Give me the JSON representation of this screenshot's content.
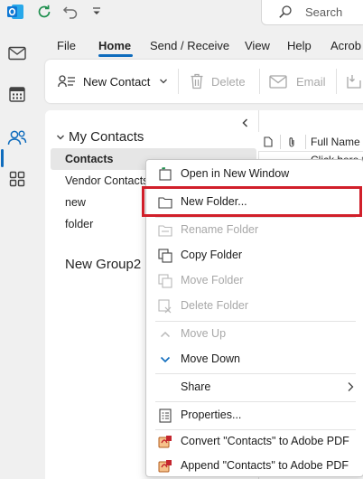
{
  "titlebar": {
    "search_label": "Search"
  },
  "tabs": [
    "File",
    "Home",
    "Send / Receive",
    "View",
    "Help",
    "Acrob"
  ],
  "ribbon": {
    "new_contact": "New Contact",
    "delete": "Delete",
    "email": "Email"
  },
  "folder_pane": {
    "header": "My Contacts",
    "items": [
      "Contacts",
      "Vendor Contacts",
      "new",
      "folder"
    ],
    "group": "New Group2"
  },
  "list_pane": {
    "col_full_name": "Full Name",
    "first_row": "Click here t"
  },
  "context_menu": {
    "items": [
      {
        "label": "Open in New Window",
        "enabled": true,
        "icon": "open-window-icon"
      },
      {
        "label": "New Folder...",
        "enabled": true,
        "icon": "folder-icon",
        "highlighted": true
      },
      {
        "label": "Rename Folder",
        "enabled": false,
        "icon": "rename-icon"
      },
      {
        "label": "Copy Folder",
        "enabled": true,
        "icon": "copy-folder-icon"
      },
      {
        "label": "Move Folder",
        "enabled": false,
        "icon": "move-folder-icon"
      },
      {
        "label": "Delete Folder",
        "enabled": false,
        "icon": "delete-folder-icon"
      },
      {
        "label": "Move Up",
        "enabled": false,
        "icon": "chevron-up-icon"
      },
      {
        "label": "Move Down",
        "enabled": true,
        "icon": "chevron-down-icon"
      },
      {
        "label": "Share",
        "enabled": true,
        "icon": "",
        "submenu": true
      },
      {
        "label": "Properties...",
        "enabled": true,
        "icon": "properties-icon"
      },
      {
        "label": "Convert \"Contacts\" to Adobe PDF",
        "enabled": true,
        "icon": "pdf-convert-icon"
      },
      {
        "label": "Append \"Contacts\" to Adobe PDF",
        "enabled": true,
        "icon": "pdf-append-icon"
      }
    ]
  },
  "colors": {
    "accent": "#0f6cbd",
    "highlight_border": "#d11f2a",
    "outlook_blue": "#0f78d4"
  }
}
